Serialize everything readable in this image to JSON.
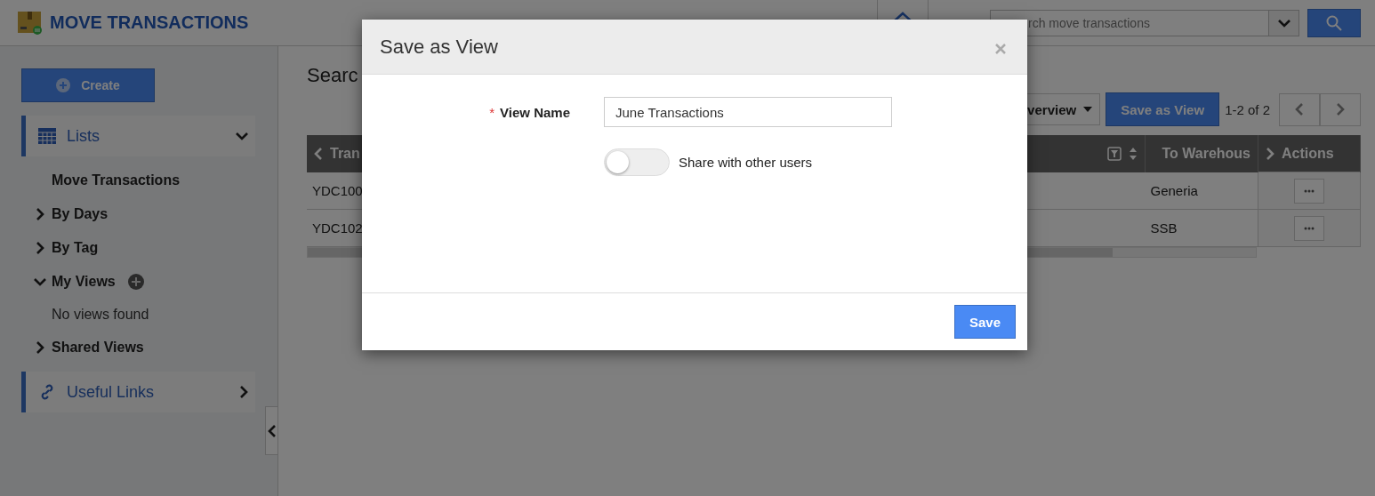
{
  "app": {
    "title": "MOVE TRANSACTIONS"
  },
  "header": {
    "search": {
      "placeholder": "rch move transactions"
    }
  },
  "sidebar": {
    "create_button": "Create",
    "sections": [
      {
        "label": "Lists",
        "expanded": true,
        "items": [
          {
            "label": "Move Transactions",
            "kind": "link"
          },
          {
            "label": "By Days",
            "kind": "group",
            "expanded": false
          },
          {
            "label": "By Tag",
            "kind": "group",
            "expanded": false
          },
          {
            "label": "My Views",
            "kind": "group",
            "expanded": true,
            "addable": true,
            "children": [
              {
                "label": "No views found",
                "kind": "note"
              }
            ]
          },
          {
            "label": "Shared Views",
            "kind": "group",
            "expanded": false
          }
        ]
      },
      {
        "label": "Useful Links",
        "expanded": false
      }
    ]
  },
  "content": {
    "title": "Searc",
    "view_dropdown": "verview",
    "save_view_button": "Save as View",
    "pagination": "1-2 of 2",
    "table": {
      "columns": [
        "Tran",
        "To Warehous",
        "Actions"
      ],
      "rows": [
        [
          "YDC100",
          "Generia"
        ],
        [
          "YDC102",
          "SSB"
        ]
      ]
    }
  },
  "modal": {
    "title": "Save as View",
    "fields": [
      {
        "label": "View Name",
        "required_mark": "*",
        "value": "June Transactions"
      }
    ],
    "toggle": {
      "label": "Share with other users",
      "on": false
    },
    "buttons": [
      "Save"
    ]
  }
}
